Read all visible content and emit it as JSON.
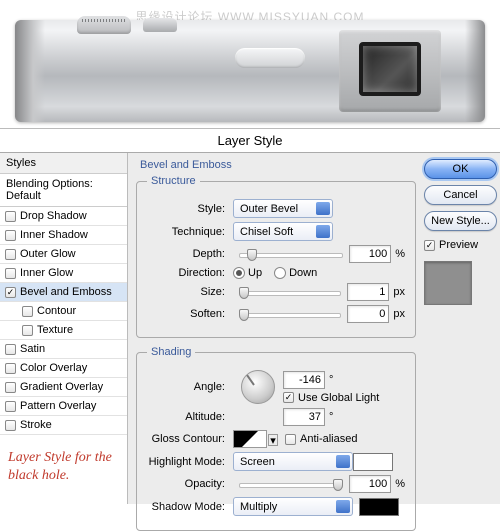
{
  "watermark": "思缘设计论坛   WWW.MISSYUAN.COM",
  "dialog_title": "Layer Style",
  "sidebar": {
    "header": "Styles",
    "blending": "Blending Options: Default",
    "items": [
      {
        "label": "Drop Shadow",
        "checked": false,
        "sub": false
      },
      {
        "label": "Inner Shadow",
        "checked": false,
        "sub": false
      },
      {
        "label": "Outer Glow",
        "checked": false,
        "sub": false
      },
      {
        "label": "Inner Glow",
        "checked": false,
        "sub": false
      },
      {
        "label": "Bevel and Emboss",
        "checked": true,
        "sub": false,
        "selected": true
      },
      {
        "label": "Contour",
        "checked": false,
        "sub": true
      },
      {
        "label": "Texture",
        "checked": false,
        "sub": true
      },
      {
        "label": "Satin",
        "checked": false,
        "sub": false
      },
      {
        "label": "Color Overlay",
        "checked": false,
        "sub": false
      },
      {
        "label": "Gradient Overlay",
        "checked": false,
        "sub": false
      },
      {
        "label": "Pattern Overlay",
        "checked": false,
        "sub": false
      },
      {
        "label": "Stroke",
        "checked": false,
        "sub": false
      }
    ]
  },
  "annotation": "Layer Style for the black hole.",
  "panel": {
    "title": "Bevel and Emboss",
    "structure": {
      "legend": "Structure",
      "style_label": "Style:",
      "style_value": "Outer Bevel",
      "technique_label": "Technique:",
      "technique_value": "Chisel Soft",
      "depth_label": "Depth:",
      "depth_value": "100",
      "depth_unit": "%",
      "direction_label": "Direction:",
      "dir_up": "Up",
      "dir_down": "Down",
      "size_label": "Size:",
      "size_value": "1",
      "size_unit": "px",
      "soften_label": "Soften:",
      "soften_value": "0",
      "soften_unit": "px"
    },
    "shading": {
      "legend": "Shading",
      "angle_label": "Angle:",
      "angle_value": "-146",
      "angle_unit": "°",
      "global_label": "Use Global Light",
      "global_checked": true,
      "altitude_label": "Altitude:",
      "altitude_value": "37",
      "altitude_unit": "°",
      "gloss_label": "Gloss Contour:",
      "aa_label": "Anti-aliased",
      "aa_checked": false,
      "hl_mode_label": "Highlight Mode:",
      "hl_mode_value": "Screen",
      "hl_color": "#ffffff",
      "hl_opacity_label": "Opacity:",
      "hl_opacity_value": "100",
      "hl_opacity_unit": "%",
      "sh_mode_label": "Shadow Mode:",
      "sh_mode_value": "Multiply",
      "sh_color": "#000000"
    }
  },
  "buttons": {
    "ok": "OK",
    "cancel": "Cancel",
    "new_style": "New Style...",
    "preview": "Preview"
  }
}
